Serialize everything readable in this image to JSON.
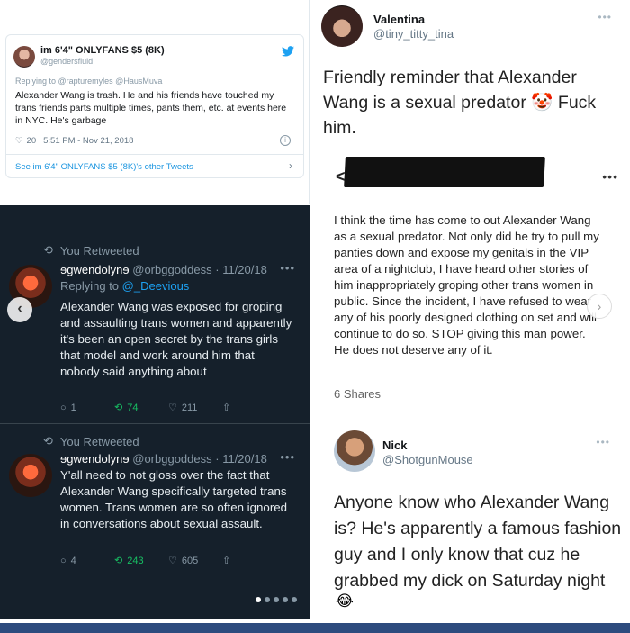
{
  "top_tweet": {
    "name": "im 6'4\" ONLYFANS $5 (8K)",
    "handle": "@gendersfluid",
    "replying_to": "Replying to @rapturemyles @HausMuva",
    "text": "Alexander Wang is trash.  He and his friends have touched my trans friends parts multiple times, pants them, etc. at events here in NYC.  He's garbage",
    "likes": "20",
    "timestamp": "5:51 PM - Nov 21, 2018",
    "footer_link": "See im 6'4\" ONLYFANS $5 (8K)'s other Tweets",
    "info_glyph": "i"
  },
  "dark_tweets": [
    {
      "retweet_label": "You Retweeted",
      "display_name": "ɘgwendolynɘ",
      "handle": "@orbggoddess",
      "date": "11/20/18",
      "replying_label": "Replying to",
      "replying_handle": "@_Deevious",
      "text": "Alexander Wang was exposed for groping and assaulting trans women and apparently it's been an open secret by the trans girls that model and work around him that nobody said anything about",
      "replies": "1",
      "retweets": "74",
      "likes": "211"
    },
    {
      "retweet_label": "You Retweeted",
      "display_name": "ɘgwendolynɘ",
      "handle": "@orbggoddess",
      "date": "11/20/18",
      "text": "Y'all need to not gloss over the fact that Alexander Wang specifically targeted trans women. Trans women are so often ignored in conversations about sexual assault.",
      "replies": "4",
      "retweets": "243",
      "likes": "605"
    }
  ],
  "valentina": {
    "name": "Valentina",
    "handle": "@tiny_titty_tina",
    "text": "Friendly reminder that Alexander Wang is a sexual predator 🤡 Fuck him."
  },
  "post": {
    "text": "I think the time has come to out Alexander Wang as a sexual predator. Not only did he try to pull my panties down and expose my genitals in the VIP area of a nightclub, I have heard other stories of him inappropriately groping other trans women in public. Since the incident, I have refused to wear any of his poorly designed clothing on set and will continue to do so. STOP giving this man power. He does not deserve any of it.",
    "shares": "6 Shares"
  },
  "nick": {
    "name": "Nick",
    "handle": "@ShotgunMouse",
    "text": "Anyone know who Alexander Wang is? He's apparently a famous fashion guy and I only know that cuz he grabbed my dick on Saturday night",
    "emoji": "😂"
  },
  "icons": {
    "more": "•••",
    "heart": "♡",
    "retweet": "⟲",
    "reply": "○",
    "share": "⇧",
    "back": "<",
    "chevron_left": "‹",
    "chevron_right": "›",
    "chevron_footer": "›"
  },
  "colors": {
    "dark_bg": "#15202b",
    "link_blue": "#1da1f2",
    "retweet_green": "#17bf63",
    "bottom_bar": "#2d4b7e"
  }
}
